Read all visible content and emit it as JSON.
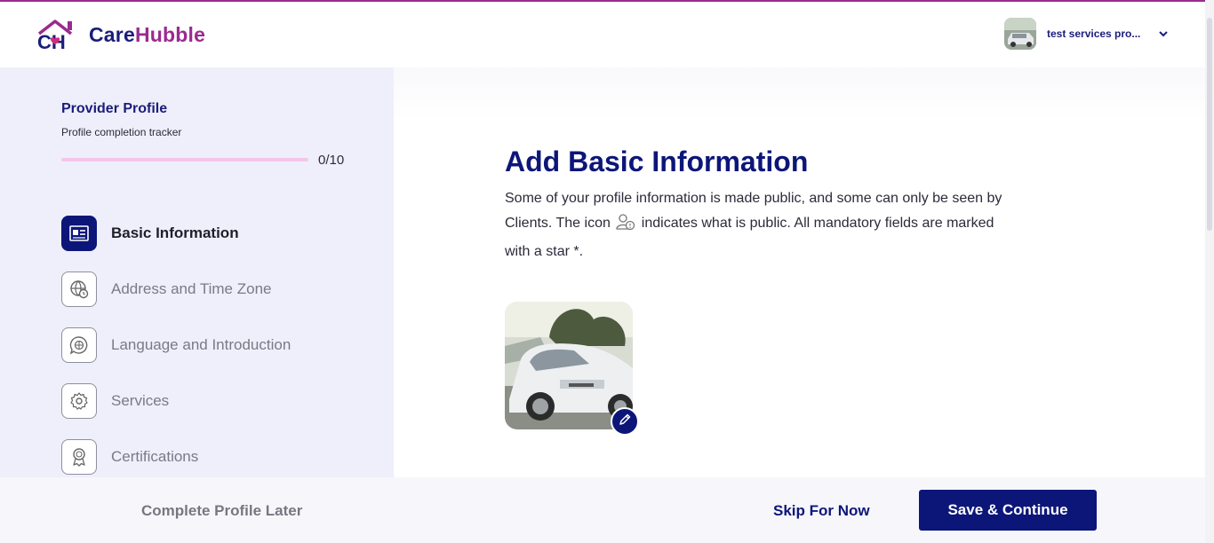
{
  "header": {
    "logo_ch": "CH",
    "logo_care": "Care",
    "logo_hubble": "Hubble",
    "user_name": "test services pro...",
    "colors": {
      "brand_navy": "#1b1d7a",
      "brand_purple": "#9b2a8f"
    }
  },
  "sidebar": {
    "title": "Provider Profile",
    "subtitle": "Profile completion tracker",
    "progress_text": "0/10",
    "progress_fraction": 0,
    "items": [
      {
        "label": "Basic Information",
        "icon": "id-card-icon",
        "active": true
      },
      {
        "label": "Address and Time Zone",
        "icon": "globe-clock-icon",
        "active": false
      },
      {
        "label": "Language and Introduction",
        "icon": "chat-globe-icon",
        "active": false
      },
      {
        "label": "Services",
        "icon": "gear-icon",
        "active": false
      },
      {
        "label": "Certifications",
        "icon": "award-icon",
        "active": false
      }
    ]
  },
  "main": {
    "title": "Add Basic Information",
    "desc_part1": "Some of your profile information is made public, and some can only be seen by Clients. The icon",
    "desc_part2": "indicates what is public. All mandatory fields are marked with a star *.",
    "photo_icon": "profile-photo",
    "edit_icon": "pencil-icon"
  },
  "footer": {
    "later_label": "Complete Profile Later",
    "skip_label": "Skip For Now",
    "save_label": "Save & Continue"
  }
}
